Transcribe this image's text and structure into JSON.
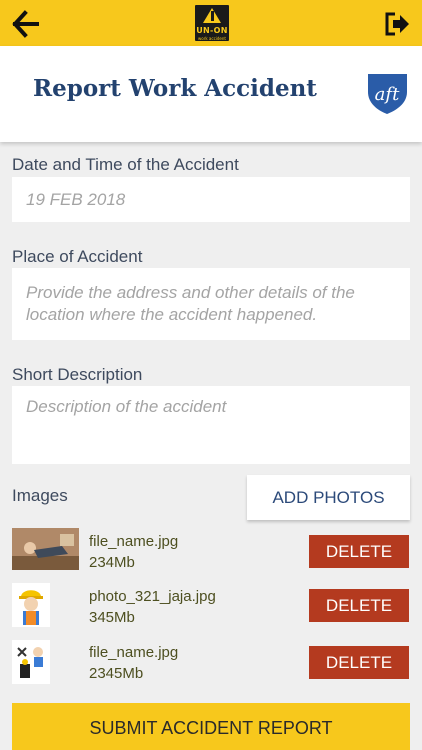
{
  "app": {
    "logo_text": "UN-ON",
    "logo_subtext": "work accident"
  },
  "header": {
    "title": "Report Work Accident"
  },
  "form": {
    "date_label": "Date and Time of the Accident",
    "date_value": "19 FEB 2018",
    "place_label": "Place of Accident",
    "place_placeholder": "Provide the address and other details of the location where the accident happened.",
    "description_label": "Short Description",
    "description_placeholder": "Description of the accident"
  },
  "images": {
    "label": "Images",
    "add_button": "ADD PHOTOS",
    "items": [
      {
        "file_name": "file_name.jpg",
        "size": "234Mb",
        "delete_label": "DELETE"
      },
      {
        "file_name": "photo_321_jaja.jpg",
        "size": "345Mb",
        "delete_label": "DELETE"
      },
      {
        "file_name": "file_name.jpg",
        "size": "2345Mb",
        "delete_label": "DELETE"
      }
    ]
  },
  "submit_label": "SUBMIT ACCIDENT REPORT",
  "colors": {
    "accent": "#f7c81c",
    "title": "#23426f",
    "delete": "#b43a1f",
    "background": "#efefef"
  },
  "icons": {
    "back": "arrow-left-icon",
    "exit": "logout-icon",
    "brand": "aft-shield-icon"
  }
}
